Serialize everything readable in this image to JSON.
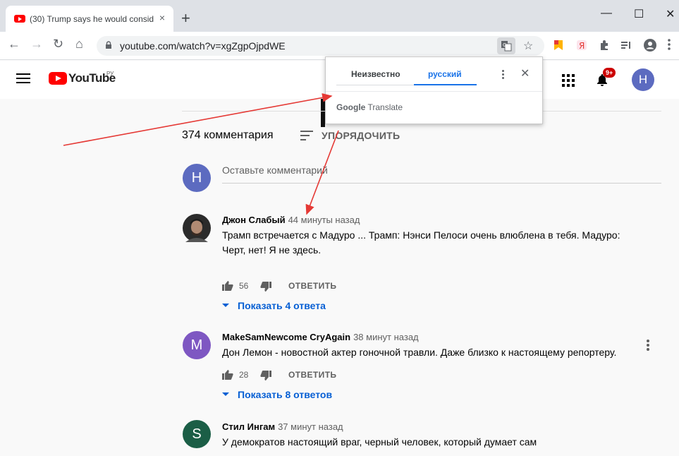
{
  "browser": {
    "tab_title": "(30) Trump says he would conside",
    "tab_close": "×",
    "new_tab": "+",
    "window_controls": [
      "—",
      "☐",
      "✕"
    ],
    "url": "youtube.com/watch?v=xgZgpOjpdWE",
    "nav": {
      "back": "←",
      "forward": "→",
      "reload": "↻",
      "home": "⌂"
    },
    "star": "☆"
  },
  "header": {
    "logo_text": "YouTube",
    "logo_region": "РУ",
    "notifications_badge": "9+",
    "account_initial": "H"
  },
  "translate_popup": {
    "source_lang": "Неизвестно",
    "target_lang": "русский",
    "close": "✕",
    "brand_google": "Google",
    "brand_translate": "Translate"
  },
  "comments": {
    "count_label": "374 комментария",
    "sort_label": "УПОРЯДОЧИТЬ",
    "add_placeholder": "Оставьте комментарий",
    "my_initial": "H",
    "items": [
      {
        "author": "Джон Слабый",
        "time": "44 минуты назад",
        "text": "Трамп встречается с Мадуро ... Трамп: Нэнси Пелоси очень влюблена в тебя. Мадуро: Черт, нет! Я не здесь.",
        "likes": "56",
        "reply": "ОТВЕТИТЬ",
        "show_replies": "Показать 4 ответа"
      },
      {
        "author": "MakeSamNewcome CryAgain",
        "time": "38 минут назад",
        "initial": "M",
        "text": "Дон Лемон - новостной актер гоночной травли. Даже близко к настоящему репортеру.",
        "likes": "28",
        "reply": "ОТВЕТИТЬ",
        "show_replies": "Показать 8 ответов"
      },
      {
        "author": "Стил Ингам",
        "time": "37 минут назад",
        "initial": "S",
        "text": "У демократов настоящий враг, черный человек, который думает сам"
      }
    ]
  },
  "colors": {
    "accent_blue": "#065fd4",
    "youtube_red": "#ff0000",
    "arrow_red": "#e53935",
    "avatar_h": "#5c6bc0",
    "avatar_m": "#7e57c2",
    "avatar_s": "#1b5e46"
  }
}
